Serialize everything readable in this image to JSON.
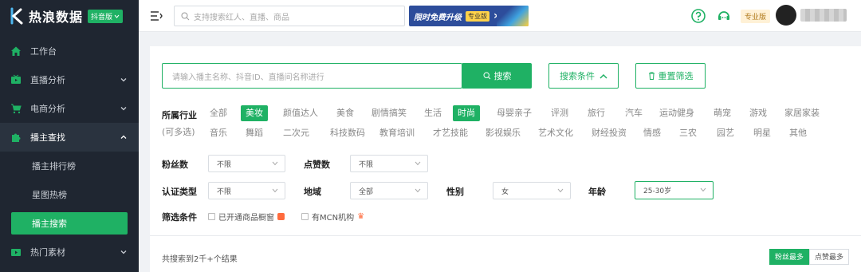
{
  "brand": {
    "name": "热浪数据",
    "platform_tag": "抖音版"
  },
  "sidebar": {
    "items": [
      {
        "label": "工作台",
        "icon": "home-icon"
      },
      {
        "label": "直播分析",
        "icon": "tv-icon"
      },
      {
        "label": "电商分析",
        "icon": "cart-icon"
      },
      {
        "label": "播主查找",
        "icon": "puzzle-icon"
      },
      {
        "label": "热门素材",
        "icon": "video-icon"
      }
    ],
    "sub_items": [
      {
        "label": "播主排行榜"
      },
      {
        "label": "星图热榜"
      },
      {
        "label": "播主搜索"
      }
    ]
  },
  "header": {
    "search_placeholder": "支持搜索红人、直播、商品",
    "promo_text": "限时免费升级",
    "promo_badge": "专业版",
    "pro_badge": "专业版"
  },
  "search_bar": {
    "placeholder": "请输入播主名称、抖音ID、直播间名称进行",
    "search_label": "搜索",
    "conditions_label": "搜索条件",
    "reset_label": "重置筛选"
  },
  "filters": {
    "industry_label": "所属行业",
    "multi_hint": "(可多选)",
    "industries_row1": [
      "全部",
      "美妆",
      "颜值达人",
      "美食",
      "剧情搞笑",
      "生活",
      "时尚",
      "母婴亲子",
      "评测",
      "旅行",
      "汽车",
      "运动健身",
      "萌宠",
      "游戏",
      "家居家装"
    ],
    "industries_row2": [
      "音乐",
      "舞蹈",
      "二次元",
      "科技数码",
      "教育培训",
      "才艺技能",
      "影视娱乐",
      "艺术文化",
      "财经投资",
      "情感",
      "三农",
      "园艺",
      "明星",
      "其他"
    ],
    "fans_label": "粉丝数",
    "fans_value": "不限",
    "likes_label": "点赞数",
    "likes_value": "不限",
    "cert_label": "认证类型",
    "cert_value": "不限",
    "region_label": "地域",
    "region_value": "全部",
    "gender_label": "性别",
    "gender_value": "女",
    "age_label": "年龄",
    "age_value": "25-30岁",
    "cond_label": "筛选条件",
    "cond_shop": "已开通商品橱窗",
    "cond_mcn": "有MCN机构"
  },
  "results": {
    "summary": "共搜索到2千+个结果",
    "sort_fans": "粉丝最多",
    "sort_likes": "点赞最多"
  },
  "colors": {
    "accent": "#1fb164",
    "sidebar_bg": "#1f2631"
  }
}
